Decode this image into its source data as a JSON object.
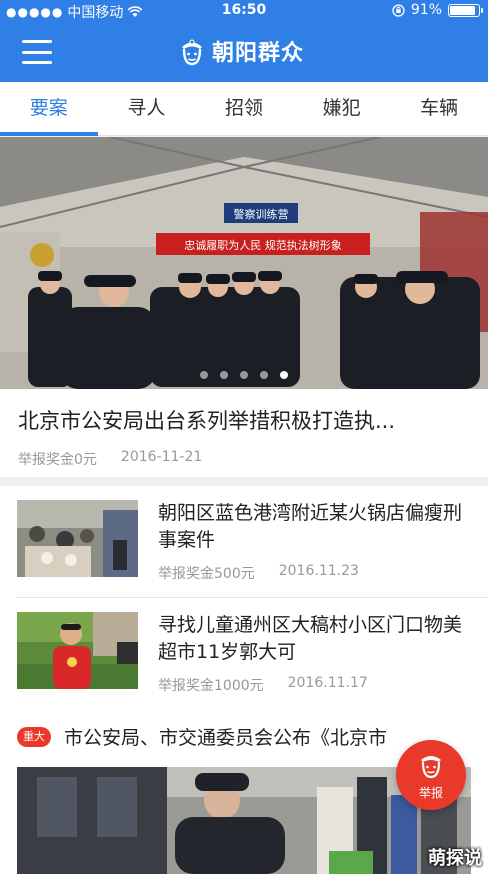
{
  "status_bar": {
    "signal": "●●●●●",
    "carrier": "中国移动",
    "wifi_icon": "wifi-icon",
    "time": "16:50",
    "battery": "91%",
    "battery_level": 0.91
  },
  "header": {
    "title": "朝阳群众",
    "menu_icon": "hamburger-menu-icon"
  },
  "tabs": [
    {
      "label": "要案",
      "active": true
    },
    {
      "label": "寻人",
      "active": false
    },
    {
      "label": "招领",
      "active": false
    },
    {
      "label": "嫌犯",
      "active": false
    },
    {
      "label": "车辆",
      "active": false
    }
  ],
  "banner": {
    "slides": 5,
    "active_slide": 4,
    "sign_text": "警察训练营",
    "slogan_text": "忠诚履职为人民 规范执法树形象"
  },
  "featured": {
    "title": "北京市公安局出台系列举措积极打造执...",
    "reward": "举报奖金0元",
    "date": "2016-11-21"
  },
  "articles": [
    {
      "title": "朝阳区蓝色港湾附近某火锅店偏瘦刑事案件",
      "reward": "举报奖金500元",
      "date": "2016.11.23"
    },
    {
      "title": "寻找儿童通州区大稿村小区门口物美超市11岁郭大可",
      "reward": "举报奖金1000元",
      "date": "2016.11.17"
    }
  ],
  "last_article": {
    "badge": "重大",
    "title": "市公安局、市交通委员会公布《北京市"
  },
  "report_button": {
    "label": "举报",
    "icon": "police-face-icon"
  },
  "watermark": "萌探说",
  "colors": {
    "primary": "#2f7fe6",
    "accent_red": "#e8392a"
  }
}
